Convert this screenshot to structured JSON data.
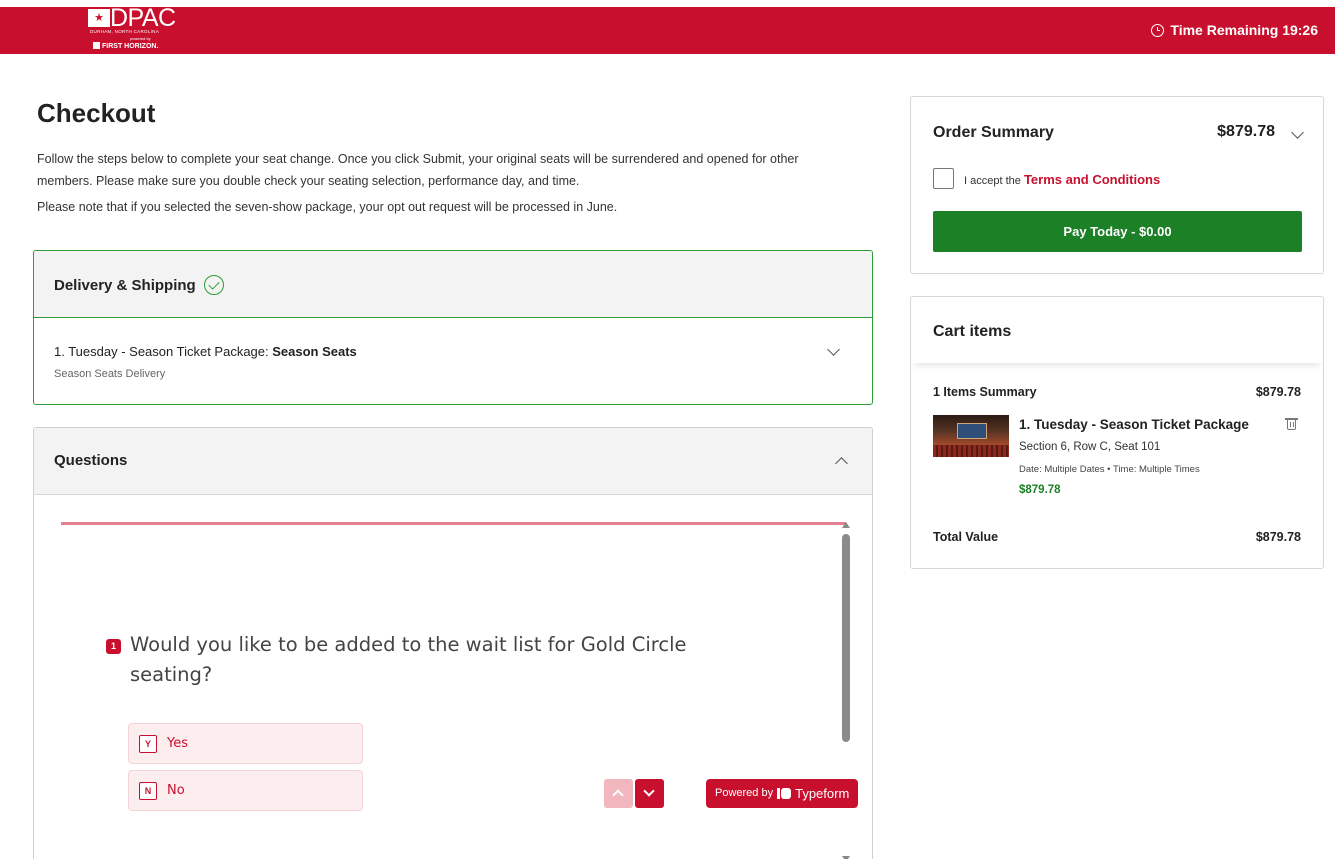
{
  "header": {
    "logo": {
      "main": "DPAC",
      "location": "DURHAM, NORTH CAROLINA",
      "powered": "powered by",
      "sponsor": "FIRST HORIZON."
    },
    "timer": "Time Remaining 19:26"
  },
  "checkout": {
    "title": "Checkout",
    "intro": "Follow the steps below to complete your seat change.  Once you click Submit, your original seats will be surrendered and opened for other members.  Please make sure you double check your seating selection, performance day, and time.",
    "note": "Please note that if you selected the seven-show package, your opt out request will be processed in June."
  },
  "delivery": {
    "title": "Delivery & Shipping",
    "item_prefix": "1. Tuesday - Season Ticket Package: ",
    "item_bold": "Season Seats",
    "item_sub": "Season Seats Delivery"
  },
  "questions": {
    "title": "Questions",
    "typeform": {
      "question_number": "1",
      "question_text": "Would you like to be added to the wait list for Gold Circle seating?",
      "choices": [
        {
          "key": "Y",
          "label": "Yes"
        },
        {
          "key": "N",
          "label": "No"
        }
      ],
      "powered_prefix": "Powered by",
      "powered_brand": "Typeform"
    }
  },
  "order_summary": {
    "title": "Order Summary",
    "amount": "$879.78",
    "terms_prefix": "I accept the ",
    "terms_link": "Terms and Conditions",
    "terms_checked": false,
    "pay_button": "Pay Today - $0.00"
  },
  "cart": {
    "title": "Cart items",
    "items_summary_label": "1 Items Summary",
    "items_summary_value": "$879.78",
    "item": {
      "name": "1. Tuesday - Season Ticket Package",
      "seat": "Section 6, Row C, Seat 101",
      "date": "Date: Multiple Dates • Time: Multiple Times",
      "price": "$879.78"
    },
    "total_label": "Total Value",
    "total_value": "$879.78"
  },
  "colors": {
    "brand_red": "#c8102e",
    "success_green": "#1c8026",
    "delivery_border": "#2e9a3a"
  }
}
